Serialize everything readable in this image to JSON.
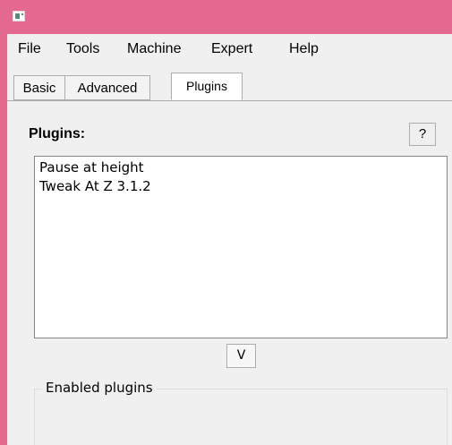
{
  "window": {
    "title": "",
    "titlebar_color": "#e3698f"
  },
  "menubar": {
    "items": [
      "File",
      "Tools",
      "Machine",
      "Expert",
      "Help"
    ]
  },
  "tabs": [
    {
      "label": "Basic",
      "active": false
    },
    {
      "label": "Advanced",
      "active": false
    },
    {
      "label": "Plugins",
      "active": true
    }
  ],
  "plugins_panel": {
    "title": "Plugins:",
    "help_label": "?",
    "items": [
      "Pause at height",
      "Tweak At Z 3.1.2"
    ],
    "move_down_label": "V",
    "enabled_group_title": "Enabled plugins"
  }
}
